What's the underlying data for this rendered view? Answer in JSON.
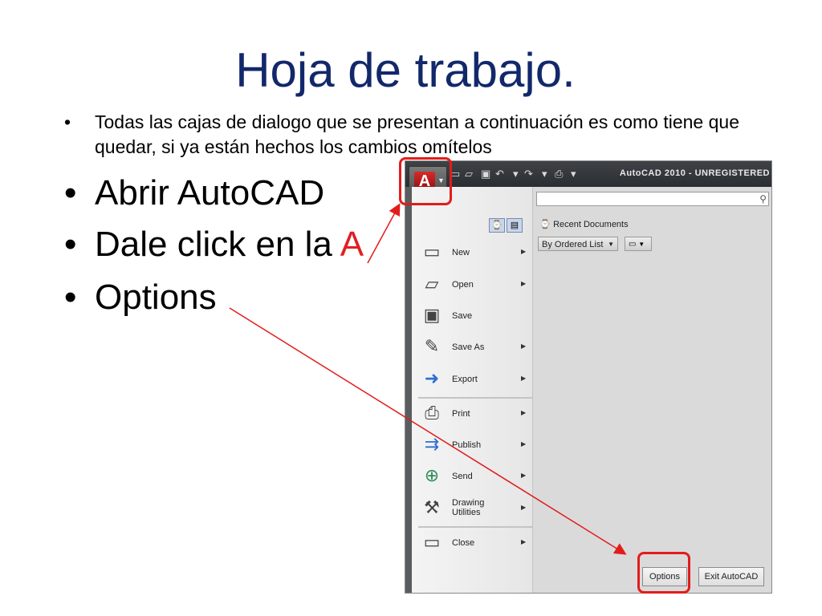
{
  "slide": {
    "title": "Hoja de trabajo.",
    "bullet_small": "Todas las cajas de dialogo que se presentan a continuación es como tiene que quedar, si ya están hechos los cambios omítelos",
    "bullet_open": "Abrir AutoCAD",
    "bullet_click_prefix": "Dale click en la ",
    "bullet_click_letter": "A",
    "bullet_options": "Options",
    "bullet_symbol": "•",
    "accent_red": "#e02020",
    "title_color": "#12286b"
  },
  "autocad": {
    "window_title": "AutoCAD 2010 - UNREGISTERED",
    "app_button_letter": "A",
    "menu_items": [
      {
        "label": "New",
        "icon": "new-document-icon"
      },
      {
        "label": "Open",
        "icon": "open-folder-icon"
      },
      {
        "label": "Save",
        "icon": "floppy-disk-icon"
      },
      {
        "label": "Save As",
        "icon": "save-as-icon"
      },
      {
        "label": "Export",
        "icon": "export-icon"
      },
      {
        "label": "Print",
        "icon": "printer-icon"
      },
      {
        "label": "Publish",
        "icon": "publish-icon"
      },
      {
        "label": "Send",
        "icon": "send-icon"
      },
      {
        "label": "Drawing Utilities",
        "icon": "wrench-document-icon"
      },
      {
        "label": "Close",
        "icon": "close-folder-icon"
      }
    ],
    "recent_documents_label": "Recent Documents",
    "order_dropdown_value": "By Ordered List",
    "options_button": "Options",
    "exit_button": "Exit AutoCAD",
    "search_value": ""
  }
}
